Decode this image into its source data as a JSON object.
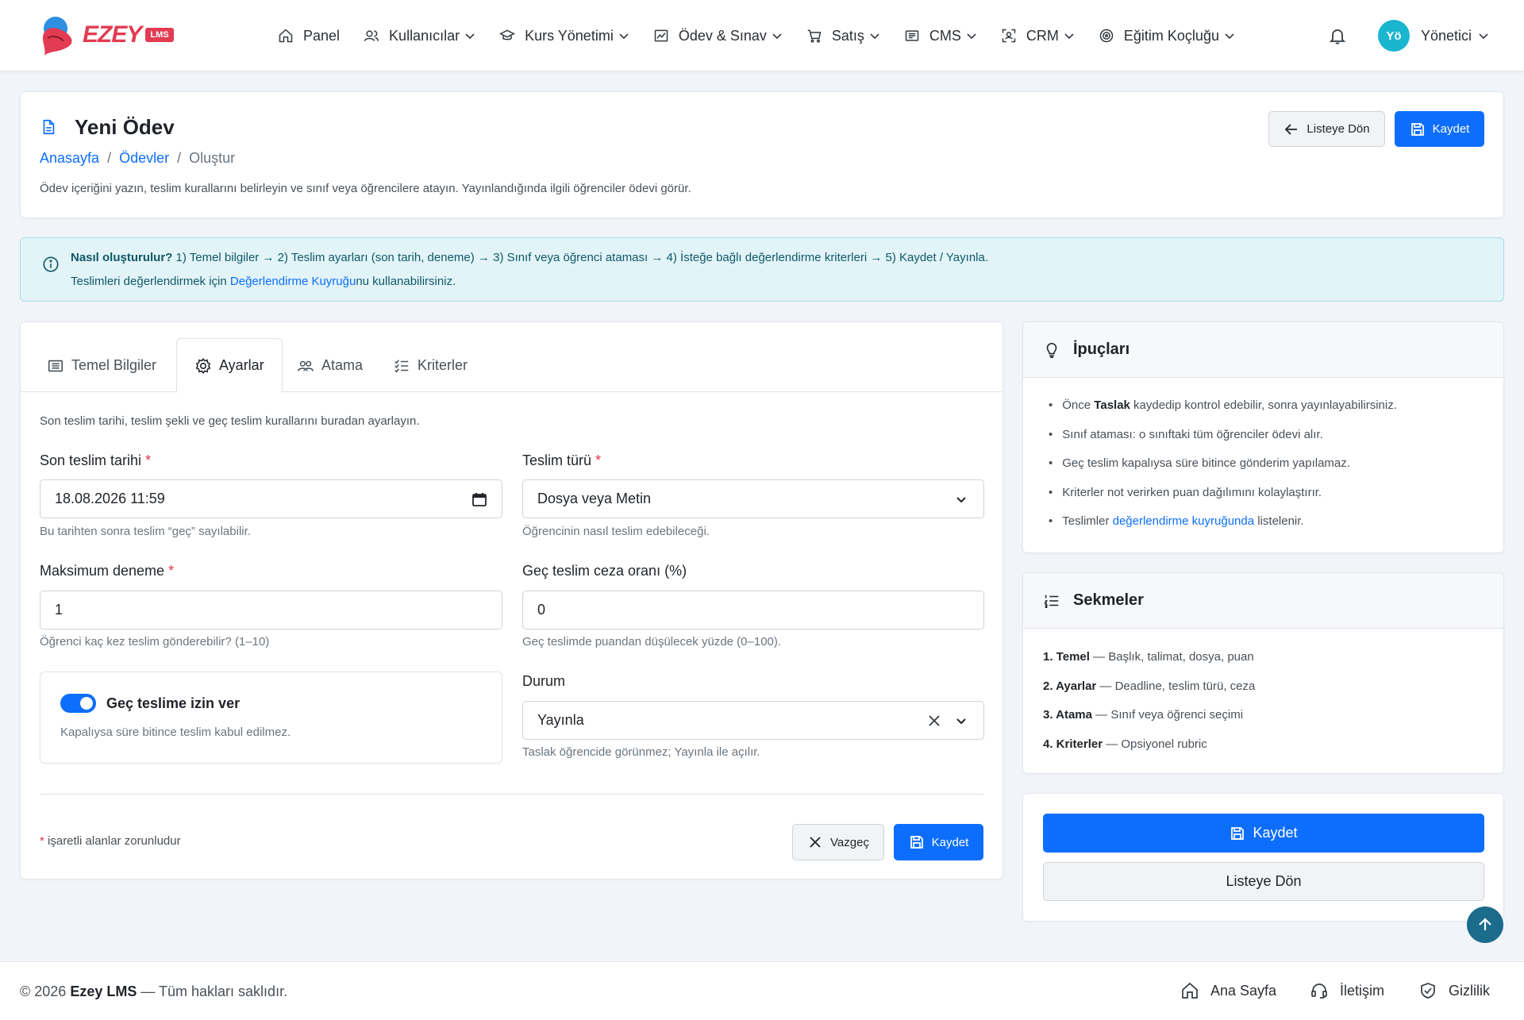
{
  "brand": {
    "name": "EZEY",
    "badge": "LMS"
  },
  "nav": {
    "items": [
      {
        "label": "Panel",
        "icon": "home-icon",
        "dropdown": false
      },
      {
        "label": "Kullanıcılar",
        "icon": "users-icon",
        "dropdown": true
      },
      {
        "label": "Kurs Yönetimi",
        "icon": "graduation-cap-icon",
        "dropdown": true
      },
      {
        "label": "Ödev & Sınav",
        "icon": "chart-icon",
        "dropdown": true
      },
      {
        "label": "Satış",
        "icon": "cart-icon",
        "dropdown": true
      },
      {
        "label": "CMS",
        "icon": "list-icon",
        "dropdown": true
      },
      {
        "label": "CRM",
        "icon": "scan-icon",
        "dropdown": true
      },
      {
        "label": "Eğitim Koçluğu",
        "icon": "target-icon",
        "dropdown": true
      }
    ],
    "user": {
      "initials": "Yö",
      "name": "Yönetici"
    }
  },
  "header": {
    "title": "Yeni Ödev",
    "breadcrumb": [
      "Anasayfa",
      "Ödevler",
      "Oluştur"
    ],
    "description": "Ödev içeriğini yazın, teslim kurallarını belirleyin ve sınıf veya öğrencilere atayın. Yayınlandığında ilgili öğrenciler ödevi görür.",
    "back_label": "Listeye Dön",
    "save_label": "Kaydet"
  },
  "alert": {
    "bold": "Nasıl oluşturulur?",
    "steps": " 1) Temel bilgiler → 2) Teslim ayarları (son tarih, deneme) → 3) Sınıf veya öğrenci ataması → 4) İsteğe bağlı değerlendirme kriterleri → 5) Kaydet / Yayınla.",
    "line2_pre": "Teslimleri değerlendirmek için ",
    "line2_link": "Değerlendirme Kuyruğu",
    "line2_post": "nu kullanabilirsiniz."
  },
  "tabs": [
    {
      "label": "Temel Bilgiler",
      "icon": "list-icon",
      "active": false
    },
    {
      "label": "Ayarlar",
      "icon": "gear-icon",
      "active": true
    },
    {
      "label": "Atama",
      "icon": "users-icon",
      "active": false
    },
    {
      "label": "Kriterler",
      "icon": "checklist-icon",
      "active": false
    }
  ],
  "form": {
    "intro": "Son teslim tarihi, teslim şekli ve geç teslim kurallarını buradan ayarlayın.",
    "due_date": {
      "label": "Son teslim tarihi",
      "value": "18.08.2026 11:59",
      "help": "Bu tarihten sonra teslim “geç” sayılabilir."
    },
    "submission_type": {
      "label": "Teslim türü",
      "value": "Dosya veya Metin",
      "help": "Öğrencinin nasıl teslim edebileceği."
    },
    "max_attempts": {
      "label": "Maksimum deneme",
      "value": "1",
      "help": "Öğrenci kaç kez teslim gönderebilir? (1–10)"
    },
    "late_penalty": {
      "label": "Geç teslim ceza oranı (%)",
      "value": "0",
      "help": "Geç teslimde puandan düşülecek yüzde (0–100)."
    },
    "allow_late": {
      "label": "Geç teslime izin ver",
      "help": "Kapalıysa süre bitince teslim kabul edilmez.",
      "enabled": true
    },
    "status": {
      "label": "Durum",
      "value": "Yayınla",
      "help": "Taslak öğrencide görünmez; Yayınla ile açılır."
    },
    "required_star": "*",
    "required_note": "işaretli alanlar zorunludur",
    "cancel_label": "Vazgeç",
    "save_label": "Kaydet"
  },
  "tips": {
    "title": "İpuçları",
    "items": [
      {
        "pre": "Önce ",
        "bold": "Taslak",
        "post": " kaydedip kontrol edebilir, sonra yayınlayabilirsiniz."
      },
      {
        "pre": "Sınıf ataması: o sınıftaki tüm öğrenciler ödevi alır."
      },
      {
        "pre": "Geç teslim kapalıysa süre bitince gönderim yapılamaz."
      },
      {
        "pre": "Kriterler not verirken puan dağılımını kolaylaştırır."
      },
      {
        "pre": "Teslimler ",
        "link": "değerlendirme kuyruğunda",
        "post": " listelenir."
      }
    ]
  },
  "sections": {
    "title": "Sekmeler",
    "items": [
      {
        "name": "1. Temel",
        "desc": " — Başlık, talimat, dosya, puan"
      },
      {
        "name": "2. Ayarlar",
        "desc": " — Deadline, teslim türü, ceza"
      },
      {
        "name": "3. Atama",
        "desc": " — Sınıf veya öğrenci seçimi"
      },
      {
        "name": "4. Kriterler",
        "desc": " — Opsiyonel rubric"
      }
    ]
  },
  "actions": {
    "save_label": "Kaydet",
    "back_label": "Listeye Dön"
  },
  "footer": {
    "copyright_pre": "© 2026 ",
    "brand": "Ezey LMS",
    "copyright_post": " — Tüm hakları saklıdır.",
    "links": [
      "Ana Sayfa",
      "İletişim",
      "Gizlilik"
    ]
  },
  "colors": {
    "primary": "#0d6efd",
    "brand": "#e23b52",
    "info_bg": "#e2f4f8",
    "avatar": "#1ab5cf"
  }
}
